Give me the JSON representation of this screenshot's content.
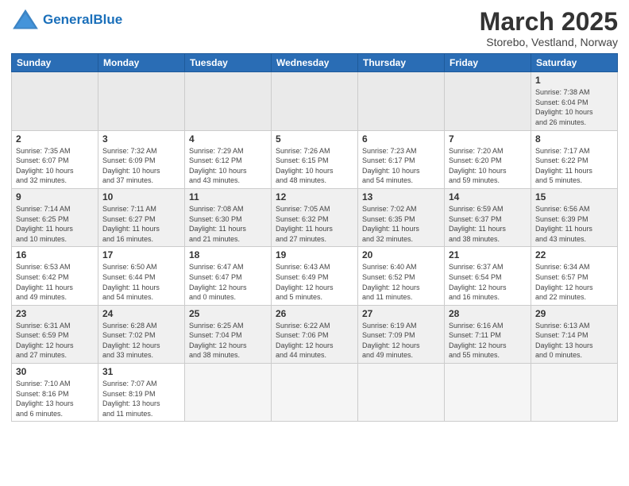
{
  "header": {
    "logo_general": "General",
    "logo_blue": "Blue",
    "title": "March 2025",
    "subtitle": "Storebo, Vestland, Norway"
  },
  "days_of_week": [
    "Sunday",
    "Monday",
    "Tuesday",
    "Wednesday",
    "Thursday",
    "Friday",
    "Saturday"
  ],
  "weeks": [
    [
      {
        "day": "",
        "info": ""
      },
      {
        "day": "",
        "info": ""
      },
      {
        "day": "",
        "info": ""
      },
      {
        "day": "",
        "info": ""
      },
      {
        "day": "",
        "info": ""
      },
      {
        "day": "",
        "info": ""
      },
      {
        "day": "1",
        "info": "Sunrise: 7:38 AM\nSunset: 6:04 PM\nDaylight: 10 hours\nand 26 minutes."
      }
    ],
    [
      {
        "day": "2",
        "info": "Sunrise: 7:35 AM\nSunset: 6:07 PM\nDaylight: 10 hours\nand 32 minutes."
      },
      {
        "day": "3",
        "info": "Sunrise: 7:32 AM\nSunset: 6:09 PM\nDaylight: 10 hours\nand 37 minutes."
      },
      {
        "day": "4",
        "info": "Sunrise: 7:29 AM\nSunset: 6:12 PM\nDaylight: 10 hours\nand 43 minutes."
      },
      {
        "day": "5",
        "info": "Sunrise: 7:26 AM\nSunset: 6:15 PM\nDaylight: 10 hours\nand 48 minutes."
      },
      {
        "day": "6",
        "info": "Sunrise: 7:23 AM\nSunset: 6:17 PM\nDaylight: 10 hours\nand 54 minutes."
      },
      {
        "day": "7",
        "info": "Sunrise: 7:20 AM\nSunset: 6:20 PM\nDaylight: 10 hours\nand 59 minutes."
      },
      {
        "day": "8",
        "info": "Sunrise: 7:17 AM\nSunset: 6:22 PM\nDaylight: 11 hours\nand 5 minutes."
      }
    ],
    [
      {
        "day": "9",
        "info": "Sunrise: 7:14 AM\nSunset: 6:25 PM\nDaylight: 11 hours\nand 10 minutes."
      },
      {
        "day": "10",
        "info": "Sunrise: 7:11 AM\nSunset: 6:27 PM\nDaylight: 11 hours\nand 16 minutes."
      },
      {
        "day": "11",
        "info": "Sunrise: 7:08 AM\nSunset: 6:30 PM\nDaylight: 11 hours\nand 21 minutes."
      },
      {
        "day": "12",
        "info": "Sunrise: 7:05 AM\nSunset: 6:32 PM\nDaylight: 11 hours\nand 27 minutes."
      },
      {
        "day": "13",
        "info": "Sunrise: 7:02 AM\nSunset: 6:35 PM\nDaylight: 11 hours\nand 32 minutes."
      },
      {
        "day": "14",
        "info": "Sunrise: 6:59 AM\nSunset: 6:37 PM\nDaylight: 11 hours\nand 38 minutes."
      },
      {
        "day": "15",
        "info": "Sunrise: 6:56 AM\nSunset: 6:39 PM\nDaylight: 11 hours\nand 43 minutes."
      }
    ],
    [
      {
        "day": "16",
        "info": "Sunrise: 6:53 AM\nSunset: 6:42 PM\nDaylight: 11 hours\nand 49 minutes."
      },
      {
        "day": "17",
        "info": "Sunrise: 6:50 AM\nSunset: 6:44 PM\nDaylight: 11 hours\nand 54 minutes."
      },
      {
        "day": "18",
        "info": "Sunrise: 6:47 AM\nSunset: 6:47 PM\nDaylight: 12 hours\nand 0 minutes."
      },
      {
        "day": "19",
        "info": "Sunrise: 6:43 AM\nSunset: 6:49 PM\nDaylight: 12 hours\nand 5 minutes."
      },
      {
        "day": "20",
        "info": "Sunrise: 6:40 AM\nSunset: 6:52 PM\nDaylight: 12 hours\nand 11 minutes."
      },
      {
        "day": "21",
        "info": "Sunrise: 6:37 AM\nSunset: 6:54 PM\nDaylight: 12 hours\nand 16 minutes."
      },
      {
        "day": "22",
        "info": "Sunrise: 6:34 AM\nSunset: 6:57 PM\nDaylight: 12 hours\nand 22 minutes."
      }
    ],
    [
      {
        "day": "23",
        "info": "Sunrise: 6:31 AM\nSunset: 6:59 PM\nDaylight: 12 hours\nand 27 minutes."
      },
      {
        "day": "24",
        "info": "Sunrise: 6:28 AM\nSunset: 7:02 PM\nDaylight: 12 hours\nand 33 minutes."
      },
      {
        "day": "25",
        "info": "Sunrise: 6:25 AM\nSunset: 7:04 PM\nDaylight: 12 hours\nand 38 minutes."
      },
      {
        "day": "26",
        "info": "Sunrise: 6:22 AM\nSunset: 7:06 PM\nDaylight: 12 hours\nand 44 minutes."
      },
      {
        "day": "27",
        "info": "Sunrise: 6:19 AM\nSunset: 7:09 PM\nDaylight: 12 hours\nand 49 minutes."
      },
      {
        "day": "28",
        "info": "Sunrise: 6:16 AM\nSunset: 7:11 PM\nDaylight: 12 hours\nand 55 minutes."
      },
      {
        "day": "29",
        "info": "Sunrise: 6:13 AM\nSunset: 7:14 PM\nDaylight: 13 hours\nand 0 minutes."
      }
    ],
    [
      {
        "day": "30",
        "info": "Sunrise: 7:10 AM\nSunset: 8:16 PM\nDaylight: 13 hours\nand 6 minutes."
      },
      {
        "day": "31",
        "info": "Sunrise: 7:07 AM\nSunset: 8:19 PM\nDaylight: 13 hours\nand 11 minutes."
      },
      {
        "day": "",
        "info": ""
      },
      {
        "day": "",
        "info": ""
      },
      {
        "day": "",
        "info": ""
      },
      {
        "day": "",
        "info": ""
      },
      {
        "day": "",
        "info": ""
      }
    ]
  ]
}
